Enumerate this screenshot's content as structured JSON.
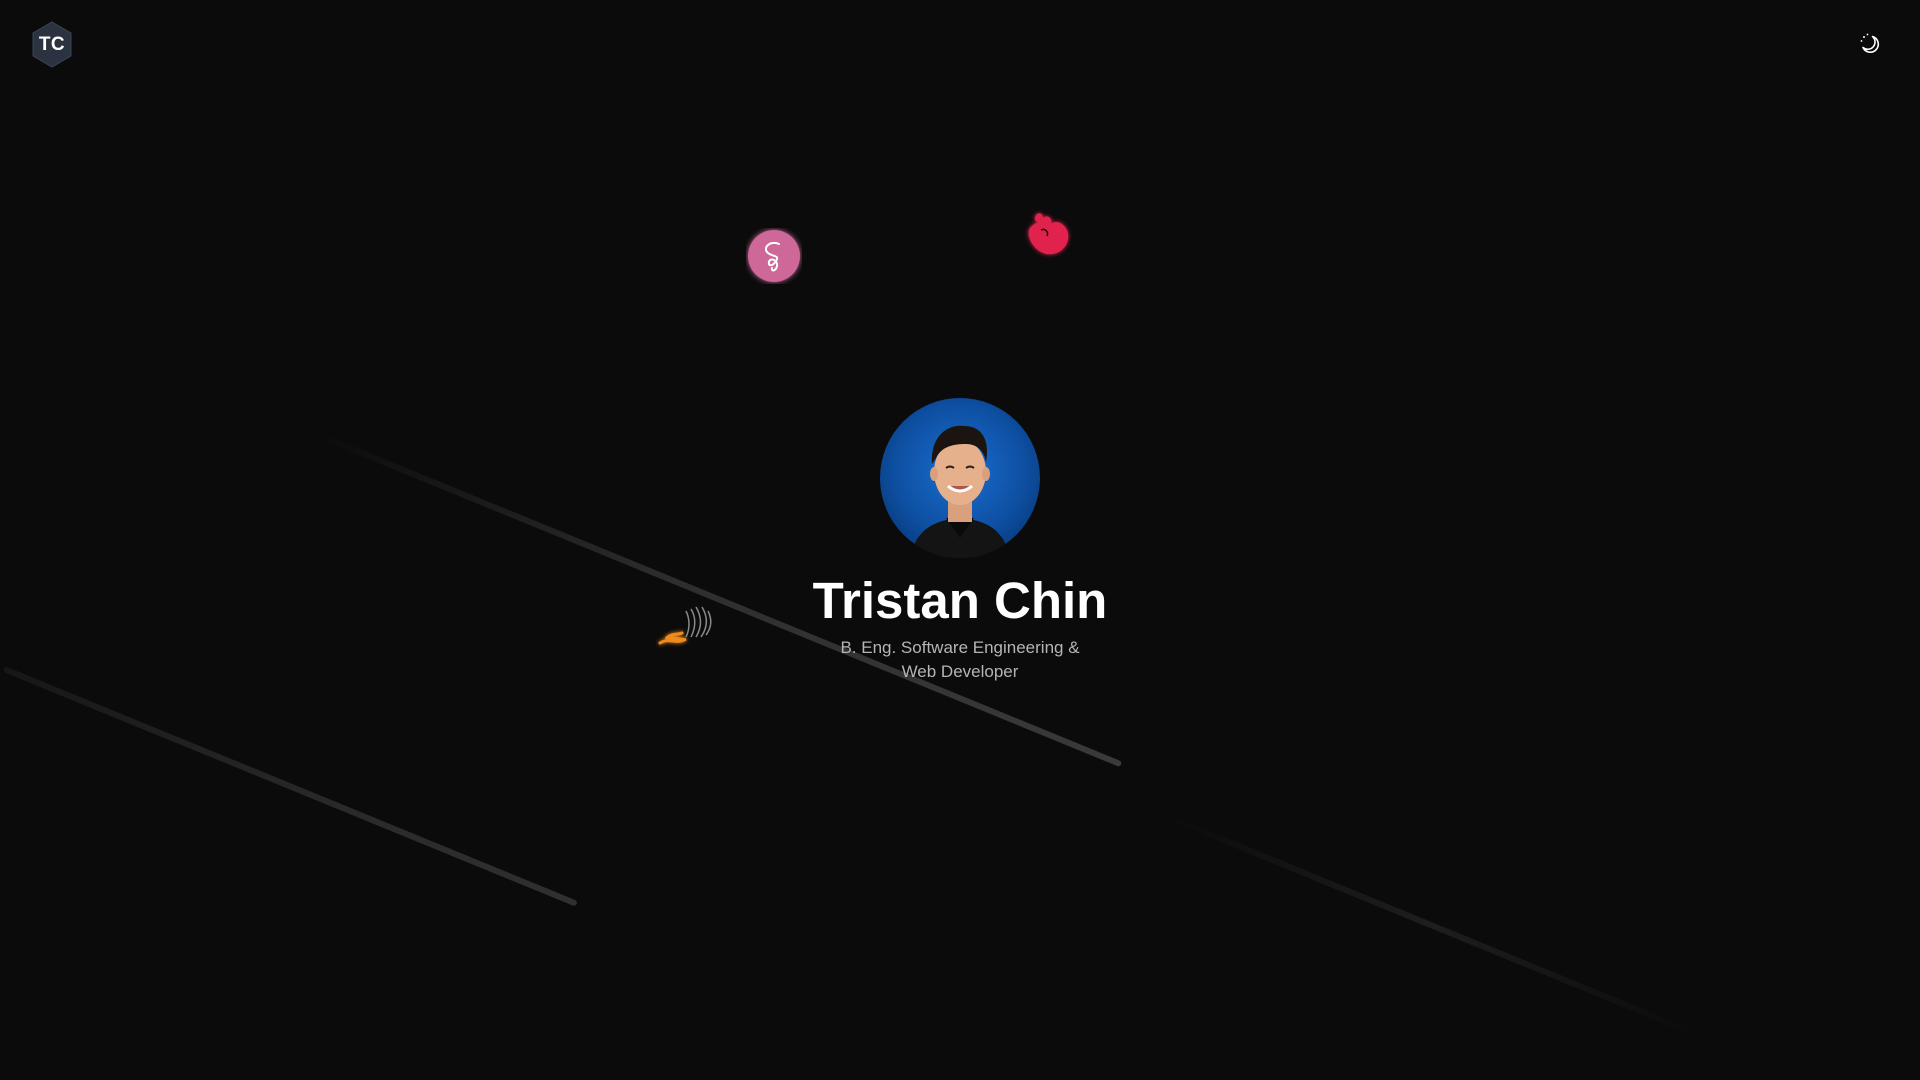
{
  "header": {
    "logo_text": "TC",
    "theme_toggle_icon": "moon-sun-icon"
  },
  "hero": {
    "avatar_icon": "profile-photo",
    "name": "Tristan Chin",
    "subtitle_line1": "B. Eng. Software Engineering &",
    "subtitle_line2": "Web Developer"
  },
  "floating_icons": [
    {
      "name": "sass-logo-icon",
      "color": "#cd6799"
    },
    {
      "name": "nestjs-logo-icon",
      "color": "#e0234e"
    },
    {
      "name": "swagger-flame-logo-icon",
      "color": "#f08a1c"
    }
  ],
  "colors": {
    "background": "#0b0b0b",
    "logo_hexagon": "#2b3340",
    "subtitle_text": "#b5b5b5",
    "avatar_background": "#0d4ea0"
  }
}
